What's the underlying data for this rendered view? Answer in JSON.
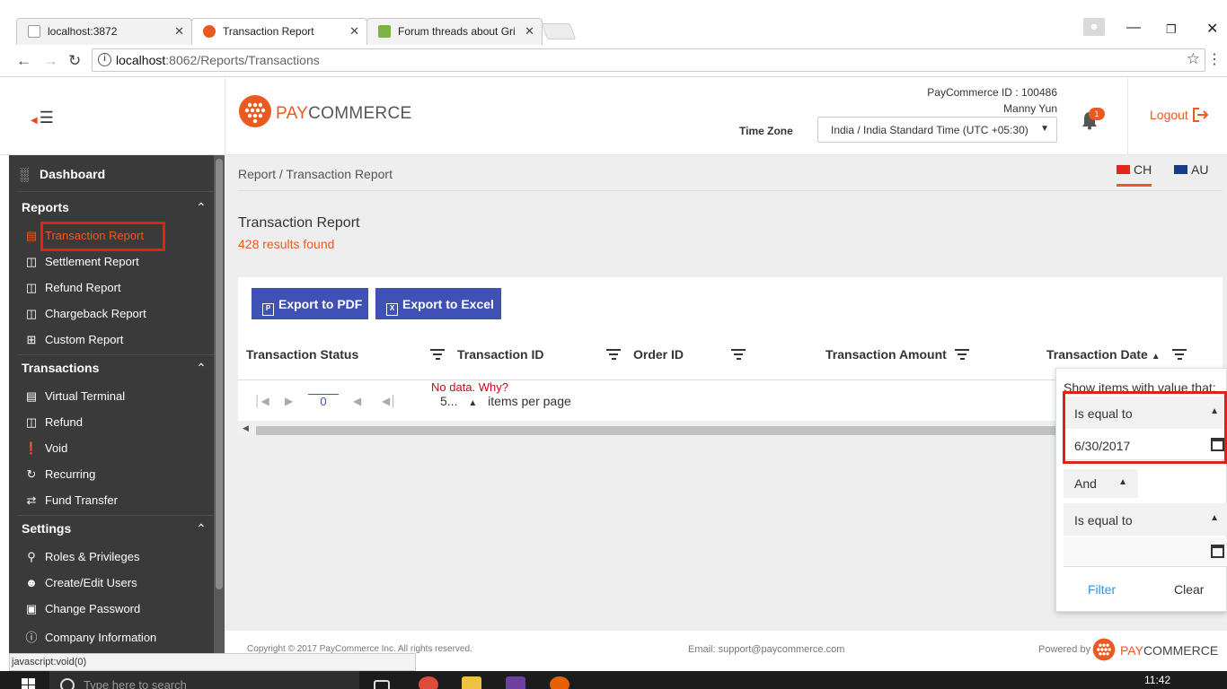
{
  "browser": {
    "tabs": [
      {
        "title": "localhost:3872",
        "close": "✕"
      },
      {
        "title": "Transaction Report",
        "close": "✕"
      },
      {
        "title": "Forum threads about Gri",
        "close": "✕"
      }
    ],
    "url_host": "localhost",
    "url_path": ":8062/Reports/Transactions",
    "info_icon": "i"
  },
  "header": {
    "logo_pay": "PAY",
    "logo_commerce": "COMMERCE",
    "merchant_id": "PayCommerce ID : 100486",
    "user_name": "Manny Yun",
    "timezone_label": "Time Zone",
    "timezone_value": "India / India Standard Time (UTC +05:30)",
    "notification_count": "1",
    "logout_label": "Logout"
  },
  "sidebar": {
    "dashboard": "Dashboard",
    "sections": [
      {
        "title": "Reports",
        "items": [
          "Transaction Report",
          "Settlement Report",
          "Refund Report",
          "Chargeback Report",
          "Custom Report"
        ]
      },
      {
        "title": "Transactions",
        "items": [
          "Virtual Terminal",
          "Refund",
          "Void",
          "Recurring",
          "Fund Transfer"
        ]
      },
      {
        "title": "Settings",
        "items": [
          "Roles & Privileges",
          "Create/Edit Users",
          "Change Password",
          "Company Information"
        ]
      }
    ]
  },
  "main": {
    "breadcrumb": "Report / Transaction Report",
    "regions": [
      "CH",
      "AU"
    ],
    "page_title": "Transaction Report",
    "results": "428 results found",
    "export_pdf": "Export to PDF",
    "export_excel": "Export to Excel",
    "columns": [
      "Transaction Status",
      "Transaction ID",
      "Order ID",
      "Transaction Amount",
      "Transaction Date"
    ],
    "sort_indicator": "▲",
    "page_number": "0",
    "page_size": "5...",
    "items_per_page": "items per page",
    "annotation": "No data. Why?"
  },
  "filter_popup": {
    "title": "Show items with value that:",
    "operator1": "Is equal to",
    "value1": "6/30/2017",
    "logic": "And",
    "operator2": "Is equal to",
    "value2": "",
    "filter_button": "Filter",
    "clear_button": "Clear"
  },
  "footer": {
    "copyright": "Copyright © 2017 PayCommerce Inc. All rights reserved.",
    "email": "Email: support@paycommerce.com",
    "powered_by": "Powered by"
  },
  "statusbar": "javascript:void(0)",
  "taskbar": {
    "search_placeholder": "Type here to search",
    "time": "11:42"
  },
  "colors": {
    "brand": "#ea5a20",
    "primary": "#3f51b5",
    "sidebar": "#3a3a3a",
    "highlight": "#e0201c"
  }
}
